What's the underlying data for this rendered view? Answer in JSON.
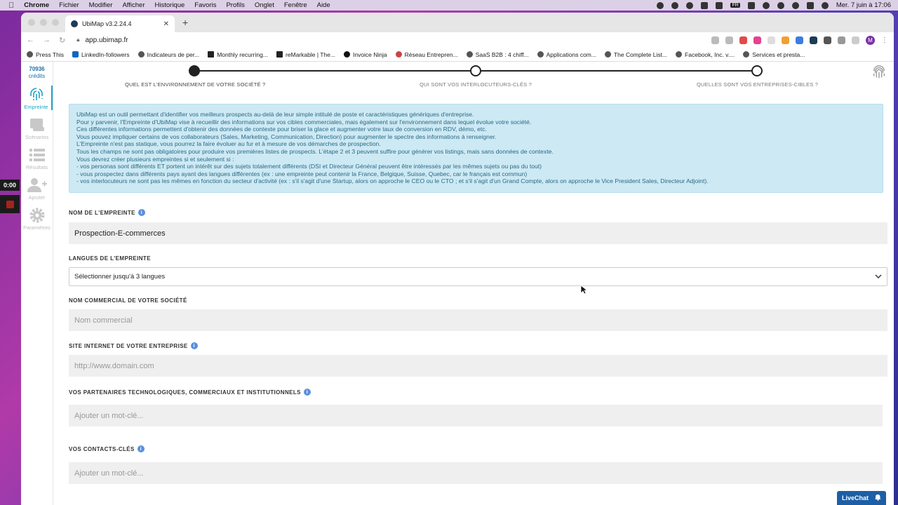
{
  "menubar": {
    "items": [
      "Chrome",
      "Fichier",
      "Modifier",
      "Afficher",
      "Historique",
      "Favoris",
      "Profils",
      "Onglet",
      "Fenêtre",
      "Aide"
    ],
    "keyboard": "FR",
    "datetime": "Mer. 7 juin à 17:06"
  },
  "recording": {
    "timer": "0:00"
  },
  "browser": {
    "tab_title": "UbiMap v3.2.24.4",
    "url": "app.ubimap.fr",
    "avatar_letter": "M",
    "bookmarks": [
      "Press This",
      "LinkedIn-followers",
      "Indicateurs de per...",
      "Monthly recurring...",
      "reMarkable | The...",
      "Invoice Ninja",
      "Réseau Entrepren...",
      "SaaS B2B : 4 chiff...",
      "Applications com...",
      "The Complete List...",
      "Facebook, Inc. v....",
      "Services et presta..."
    ]
  },
  "sidebar": {
    "credits_value": "70936",
    "credits_label": "crédits",
    "items": [
      {
        "label": "Empreinte",
        "icon": "fingerprint-icon",
        "active": true
      },
      {
        "label": "Scénarios",
        "icon": "scenarios-icon",
        "active": false
      },
      {
        "label": "Résultats",
        "icon": "list-icon",
        "active": false
      },
      {
        "label": "Ajouter",
        "icon": "add-user-icon",
        "active": false
      },
      {
        "label": "Paramètres",
        "icon": "gear-icon",
        "active": false
      }
    ]
  },
  "stepper": {
    "steps": [
      {
        "label": "QUEL EST L'ENVIRONNEMENT DE VOTRE SOCIÉTÉ ?",
        "done": true
      },
      {
        "label": "QUI SONT VOS INTERLOCUTEURS-CLÉS ?",
        "done": false
      },
      {
        "label": "QUELLES SONT VOS ENTREPRISES-CIBLES ?",
        "done": false
      }
    ]
  },
  "info_box": {
    "lines": [
      "UbiMap est un outil permettant d'identifier vos meilleurs prospects au-delà de leur simple intitulé de poste et caractéristiques génériques d'entreprise.",
      "Pour y parvenir, l'Empreinte d'UbiMap vise à recueillir des informations sur vos cibles commerciales, mais également sur l'environnement dans lequel évolue votre société.",
      "Ces différentes informations permettent d'obtenir des données de contexte pour briser la glace et augmenter votre taux de conversion en RDV, démo, etc.",
      "Vous pouvez impliquer certains de vos collaborateurs (Sales, Marketing, Communication, Direction) pour augmenter le spectre des informations à renseigner.",
      "L'Empreinte n'est pas statique, vous pourrez la faire évoluer au fur et à mesure de vos démarches de prospection.",
      "Tous les champs ne sont pas obligatoires pour produire vos premières listes de prospects. L'étape 2 et 3 peuvent suffire pour générer vos listings, mais sans données de contexte.",
      "Vous devrez créer plusieurs empreintes si et seulement si :",
      "- vos personas sont différents ET portent un intérêt sur des sujets totalement différents (DSI et Directeur Général peuvent être intéressés par les mêmes sujets ou pas du tout)",
      "- vous prospectez dans différents pays ayant des langues différentes (ex : une empreinte peut contenir la France, Belgique, Suisse, Quebec, car le français est commun)",
      "- vos interlocuteurs ne sont pas les mêmes en fonction du secteur d'activité (ex : s'il s'agit d'une Startup, alors on approche le CEO ou le CTO ; et s'il s'agit d'un Grand Compte, alors on approche le Vice President Sales, Directeur Adjoint)."
    ]
  },
  "form": {
    "name_label": "NOM DE L'EMPREINTE",
    "name_value": "Prospection-E-commerces",
    "languages_label": "LANGUES DE L'EMPREINTE",
    "languages_placeholder": "Sélectionner jusqu'à 3 langues",
    "company_label": "NOM COMMERCIAL DE VOTRE SOCIÉTÉ",
    "company_placeholder": "Nom commercial",
    "website_label": "SITE INTERNET DE VOTRE ENTREPRISE",
    "website_placeholder": "http://www.domain.com",
    "partners_label": "VOS PARTENAIRES TECHNOLOGIQUES, COMMERCIAUX ET INSTITUTIONNELS",
    "partners_placeholder": "Ajouter un mot-clé...",
    "contacts_label": "VOS CONTACTS-CLÉS",
    "contacts_placeholder": "Ajouter un mot-clé..."
  },
  "livechat": {
    "label": "LiveChat"
  },
  "colors": {
    "accent": "#1aa5c8",
    "info_bg": "#cde9f4",
    "info_text": "#2a6a85",
    "livechat": "#1c5fa6"
  }
}
